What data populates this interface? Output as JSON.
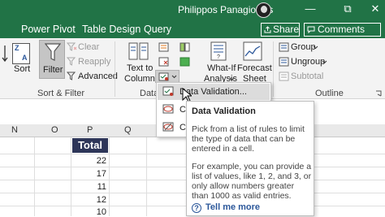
{
  "titlebar": {
    "user_name": "Philippos Panagiotidis",
    "restore_glyph": "⧉",
    "close_glyph": "✕",
    "minimize_glyph": "—"
  },
  "tabs": [
    {
      "label": "Power Pivot"
    },
    {
      "label": "Table Design"
    },
    {
      "label": "Query"
    }
  ],
  "share_label": "Share",
  "comments_label": "Comments",
  "ribbon": {
    "sort_label": "Sort",
    "filter_label": "Filter",
    "clear_label": "Clear",
    "reapply_label": "Reapply",
    "advanced_label": "Advanced",
    "sort_filter_group": "Sort & Filter",
    "text_to_columns_line1": "Text to",
    "text_to_columns_line2": "Columns",
    "data_tools_group_partial": "Data",
    "whatif_line1": "What-If",
    "whatif_line2": "Analysis",
    "forecast_line1": "Forecast",
    "forecast_line2": "Sheet",
    "group_label": "Group",
    "ungroup_label": "Ungroup",
    "subtotal_label": "Subtotal",
    "outline_group": "Outline",
    "za_top": "Z",
    "za_bottom": "A"
  },
  "columns": [
    "N",
    "O",
    "P",
    "Q"
  ],
  "table": {
    "header": "Total",
    "values": [
      "22",
      "17",
      "11",
      "12",
      "10"
    ]
  },
  "menu": {
    "items": [
      {
        "label": "Data Validation...",
        "highlighted": true
      },
      {
        "label": "C",
        "highlighted": false
      },
      {
        "label": "C",
        "highlighted": false
      }
    ]
  },
  "tooltip": {
    "title": "Data Validation",
    "para1": "Pick from a list of rules to limit the type of data that can be entered in a cell.",
    "para2": "For example, you can provide a list of values, like 1, 2, and 3, or only allow numbers greater than 1000 as valid entries.",
    "tell_more": "Tell me more"
  },
  "colors": {
    "excel_green": "#217346",
    "total_header_bg": "#2e3659",
    "link_blue": "#2b579a"
  }
}
